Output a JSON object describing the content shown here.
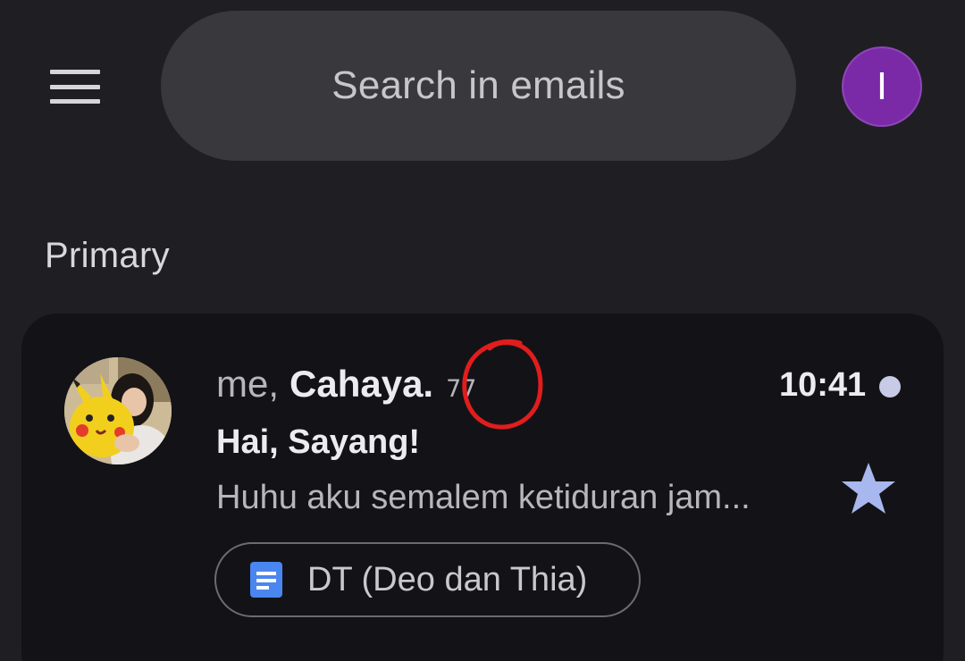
{
  "search": {
    "placeholder": "Search in emails"
  },
  "account": {
    "initial": "I",
    "color": "#7a2aa6"
  },
  "section": {
    "label": "Primary"
  },
  "email": {
    "sender_me": "me,",
    "sender_name": "Cahaya.",
    "thread_count": "77",
    "time": "10:41",
    "unread": true,
    "subject": "Hai, Sayang!",
    "snippet": "Huhu aku semalem ketiduran jam...",
    "starred": true,
    "attachment": {
      "label": "DT (Deo dan Thia)",
      "icon": "google-docs-icon"
    }
  },
  "colors": {
    "background": "#1f1f23",
    "search_bar": "#38383d",
    "card": "#131317",
    "star": "#a8b8ee",
    "doc_icon": "#4a86f0",
    "annotation": "#e11d1d"
  }
}
